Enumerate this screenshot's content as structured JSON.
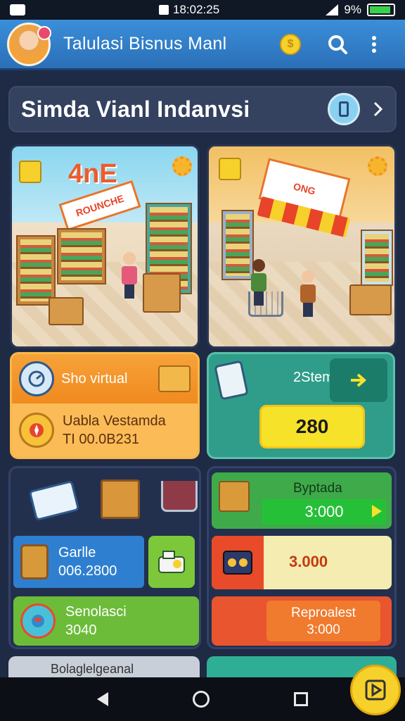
{
  "status_bar": {
    "time": "18:02:25",
    "battery": "9%"
  },
  "app_bar": {
    "title": "Talulasi Bisnus Manl",
    "coin_symbol": "$"
  },
  "banner": {
    "title": "Simda Vianl Indanvsi"
  },
  "scenes": {
    "left": {
      "sign_big": "4nЕ",
      "sign_small": "ROUNCHE"
    },
    "right": {
      "sign_small": "ONG"
    }
  },
  "orange_card": {
    "label": "Sho virtual",
    "detail_line1": "Uabla Vestamda",
    "detail_line2": "TI 00.0B231"
  },
  "teal_card": {
    "label": "2Stem",
    "value": "280"
  },
  "left_panel": {
    "blue_row": {
      "line1": "Garlle",
      "line2": "006.2800"
    },
    "green_row": {
      "line1": "Senolasci",
      "line2": "3040"
    }
  },
  "right_panel": {
    "green_top": {
      "label": "Byptada",
      "value": "3:000"
    },
    "yellow_row": {
      "value": "3.000"
    },
    "red_row": {
      "line1": "Reproalest",
      "line2": "3:000"
    }
  },
  "peek_left": {
    "label": "Bolaglelgeanal"
  },
  "colors": {
    "accent": "#3a8fd8",
    "orange": "#f48a1e",
    "teal": "#2f9d8a",
    "yellow": "#f7d12b"
  }
}
